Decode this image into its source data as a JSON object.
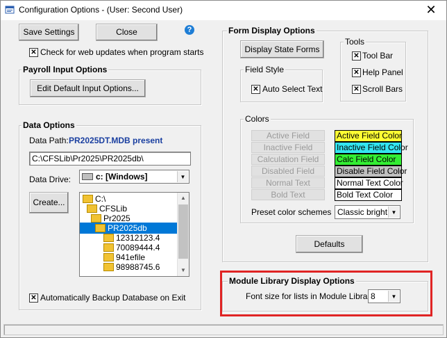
{
  "window": {
    "title": "Configuration Options - (User: Second User)",
    "close_glyph": "✕"
  },
  "top": {
    "save_label": "Save Settings",
    "close_label": "Close",
    "web_updates_label": "Check for web updates when program starts",
    "web_updates_checked": true
  },
  "payroll": {
    "title": "Payroll Input Options",
    "edit_default_label": "Edit Default Input Options..."
  },
  "data_options": {
    "title": "Data Options",
    "data_path_label": "Data Path:",
    "data_path_status": "PR2025DT.MDB present",
    "path_value": "C:\\CFSLib\\Pr2025\\PR2025db\\",
    "drive_label": "Data Drive:",
    "drive_value": "c: [Windows]",
    "create_label": "Create...",
    "folders": [
      {
        "name": "C:\\",
        "indent": 0,
        "selected": false
      },
      {
        "name": "CFSLib",
        "indent": 1,
        "selected": false
      },
      {
        "name": "Pr2025",
        "indent": 2,
        "selected": false
      },
      {
        "name": "PR2025db",
        "indent": 3,
        "selected": true
      },
      {
        "name": "12312123.4",
        "indent": 4,
        "selected": false
      },
      {
        "name": "70089444.4",
        "indent": 4,
        "selected": false
      },
      {
        "name": "941efile",
        "indent": 4,
        "selected": false
      },
      {
        "name": "98988745.6",
        "indent": 4,
        "selected": false
      }
    ],
    "auto_backup_label": "Automatically Backup Database on Exit",
    "auto_backup_checked": true
  },
  "form_display": {
    "title": "Form Display Options",
    "display_state_forms_label": "Display State Forms",
    "field_style_title": "Field Style",
    "auto_select_text_label": "Auto Select Text",
    "auto_select_checked": true,
    "tools_title": "Tools",
    "tools": [
      {
        "label": "Tool Bar",
        "checked": true
      },
      {
        "label": "Help Panel",
        "checked": true
      },
      {
        "label": "Scroll Bars",
        "checked": true
      }
    ],
    "colors_title": "Colors",
    "color_buttons": [
      "Active Field",
      "Inactive Field",
      "Calculation Field",
      "Disabled Field",
      "Normal Text",
      "Bold Text"
    ],
    "swatches": [
      {
        "label": "Active Field Color",
        "bg": "#ffff33",
        "fg": "#000000"
      },
      {
        "label": "Inactive Field Color",
        "bg": "#33e5f0",
        "fg": "#000000"
      },
      {
        "label": "Calc Field Color",
        "bg": "#33ee33",
        "fg": "#000000"
      },
      {
        "label": "Disable Field Color",
        "bg": "#c0c0c0",
        "fg": "#000000"
      },
      {
        "label": "Normal Text Color",
        "bg": "#ffffff",
        "fg": "#000000"
      },
      {
        "label": "Bold Text Color",
        "bg": "#ffffff",
        "fg": "#000000"
      }
    ],
    "preset_label": "Preset color schemes",
    "preset_value": "Classic bright",
    "defaults_label": "Defaults"
  },
  "module_library": {
    "title": "Module Library Display Options",
    "font_size_label": "Font size for lists in Module Library",
    "font_size_value": "8"
  },
  "colors": {
    "highlight": "#e02424",
    "selection": "#0078d7",
    "data_path_status": "#1a3fa0"
  }
}
